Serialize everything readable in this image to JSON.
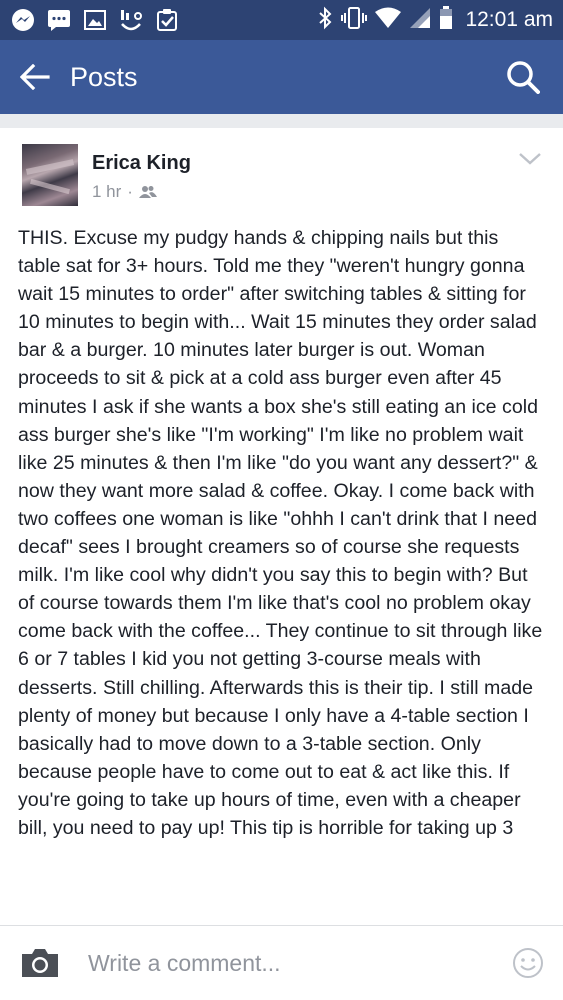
{
  "status_bar": {
    "time": "12:01 am",
    "left_icons": [
      "messenger-icon",
      "sms-icon",
      "gallery-icon",
      "voicemail-icon",
      "clipboard-check-icon"
    ],
    "right_icons": [
      "bluetooth-icon",
      "vibrate-icon",
      "wifi-icon",
      "signal-icon",
      "battery-icon"
    ]
  },
  "app_bar": {
    "title": "Posts",
    "back_icon": "back-arrow-icon",
    "search_icon": "search-icon"
  },
  "post": {
    "author": "Erica King",
    "time": "1 hr",
    "separator": "·",
    "audience_icon": "friends-icon",
    "body": "THIS. Excuse my pudgy hands & chipping nails but this table sat for 3+ hours. Told me they \"weren't hungry gonna wait 15 minutes to order\" after switching tables & sitting for 10 minutes to begin with... Wait 15 minutes they order salad bar & a burger. 10 minutes later burger is out. Woman proceeds to sit & pick at a cold ass burger even after 45 minutes I ask if she wants a box she's still eating an ice cold ass burger she's like \"I'm working\" I'm like no problem wait like 25 minutes & then I'm like \"do you want any dessert?\" & now they want more salad & coffee. Okay. I come back with two coffees one woman is like \"ohhh I can't drink that I need decaf\" sees I brought creamers so of course she requests milk. I'm like cool why didn't you say this to begin with? But of course towards them I'm like that's cool no problem okay come back with the coffee... They continue to sit through like 6 or 7 tables I kid you not getting 3-course meals with desserts. Still chilling. Afterwards this is their tip. I still made plenty of money but because I only have a 4-table section I basically had to move down to a 3-table section. Only because people have to come out to eat & act like this. If you're going to take up hours of time, even with a cheaper bill, you need to pay up! This tip is horrible for taking up 3"
  },
  "comment_bar": {
    "placeholder": "Write a comment...",
    "value": "",
    "camera_icon": "camera-icon",
    "emoji_icon": "emoji-icon"
  },
  "colors": {
    "status_bar": "#2d4373",
    "app_bar": "#3b5998",
    "text": "#1d2129",
    "meta": "#90949c",
    "divider": "#e9ebee"
  }
}
